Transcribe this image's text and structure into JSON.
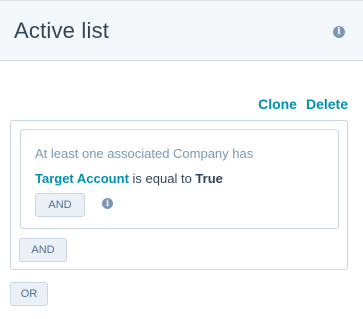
{
  "header": {
    "title": "Active list",
    "info_icon": "info-icon"
  },
  "actions": {
    "clone_label": "Clone",
    "delete_label": "Delete"
  },
  "filter_group": {
    "subject": "At least one associated Company has",
    "rule": {
      "property": "Target Account",
      "operator": "is equal to",
      "value": "True"
    },
    "inner_and_label": "AND",
    "info_icon": "info-icon"
  },
  "outer_and_label": "AND",
  "or_label": "OR",
  "colors": {
    "accent": "#0091ae",
    "text": "#33475b",
    "muted": "#7c98b6",
    "border": "#cbd6e2",
    "header_bg": "#f5f8fa",
    "button_bg": "#eaf0f6"
  }
}
